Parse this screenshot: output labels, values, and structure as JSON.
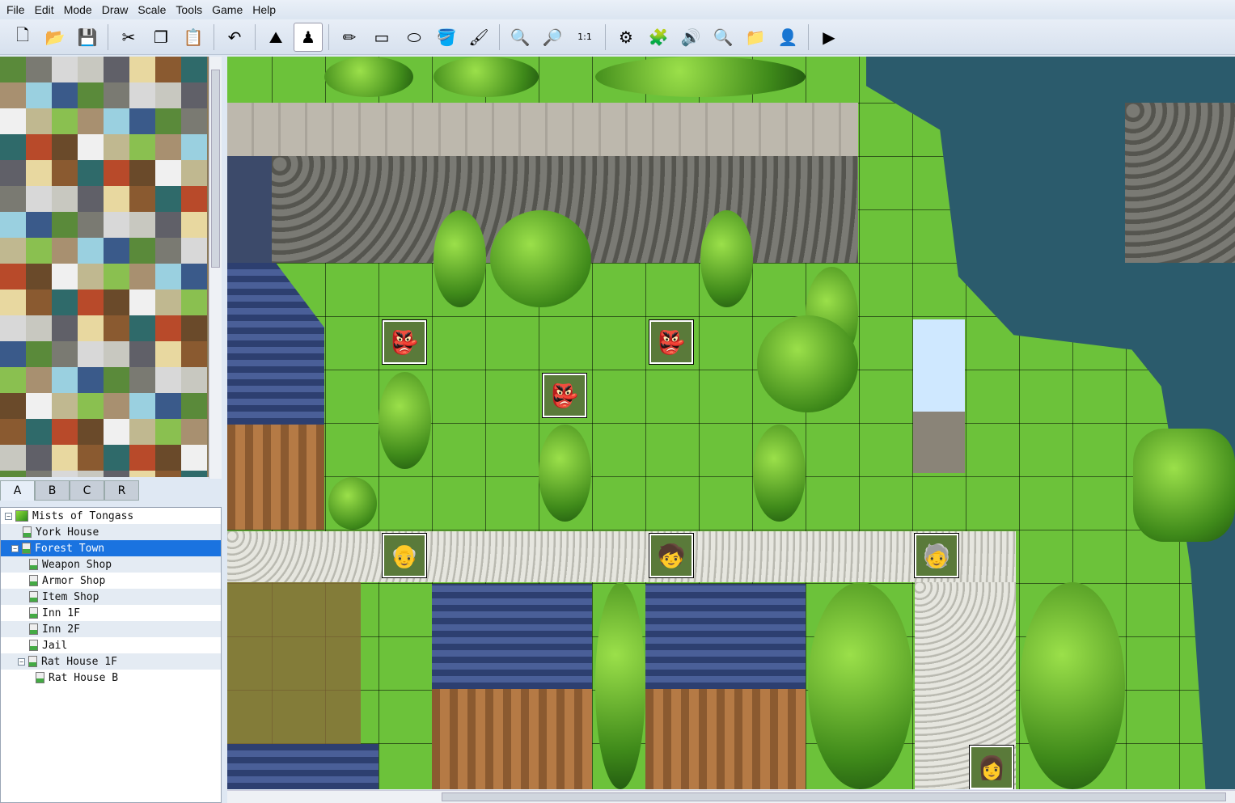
{
  "menu": [
    "File",
    "Edit",
    "Mode",
    "Draw",
    "Scale",
    "Tools",
    "Game",
    "Help"
  ],
  "toolbar": [
    {
      "icon": "new-project-icon",
      "g": "🗋"
    },
    {
      "icon": "open-project-icon",
      "g": "📂"
    },
    {
      "icon": "save-icon",
      "g": "💾"
    },
    "sep",
    {
      "icon": "cut-icon",
      "g": "✂"
    },
    {
      "icon": "copy-icon",
      "g": "❐"
    },
    {
      "icon": "paste-icon",
      "g": "📋"
    },
    "sep",
    {
      "icon": "undo-icon",
      "g": "↶"
    },
    "sep",
    {
      "icon": "map-mode-icon",
      "g": "⛰"
    },
    {
      "icon": "event-mode-icon",
      "g": "♟",
      "active": true
    },
    "sep",
    {
      "icon": "pencil-icon",
      "g": "✏"
    },
    {
      "icon": "rectangle-icon",
      "g": "▭"
    },
    {
      "icon": "ellipse-icon",
      "g": "⬭"
    },
    {
      "icon": "fill-icon",
      "g": "🪣"
    },
    {
      "icon": "shadow-pen-icon",
      "g": "🖌"
    },
    "sep",
    {
      "icon": "zoom-in-icon",
      "g": "🔍"
    },
    {
      "icon": "zoom-out-icon",
      "g": "🔎"
    },
    {
      "icon": "zoom-actual-icon",
      "g": "1:1"
    },
    "sep",
    {
      "icon": "database-icon",
      "g": "⚙"
    },
    {
      "icon": "resource-manager-icon",
      "g": "🧩"
    },
    {
      "icon": "sound-test-icon",
      "g": "🔊"
    },
    {
      "icon": "script-search-icon",
      "g": "🔍"
    },
    {
      "icon": "open-folder-icon",
      "g": "📁"
    },
    {
      "icon": "character-generator-icon",
      "g": "👤"
    },
    "sep",
    {
      "icon": "playtest-icon",
      "g": "▶"
    }
  ],
  "tileset_tabs": [
    "A",
    "B",
    "C",
    "R"
  ],
  "map_tree": [
    {
      "label": "Mists of Tongass",
      "level": 0,
      "expanded": true,
      "root": true
    },
    {
      "label": "York House",
      "level": 1
    },
    {
      "label": "Forest Town",
      "level": 1,
      "expanded": true,
      "selected": true
    },
    {
      "label": "Weapon Shop",
      "level": 2
    },
    {
      "label": "Armor Shop",
      "level": 2
    },
    {
      "label": "Item Shop",
      "level": 2
    },
    {
      "label": "Inn 1F",
      "level": 2
    },
    {
      "label": "Inn 2F",
      "level": 2
    },
    {
      "label": "Jail",
      "level": 2
    },
    {
      "label": "Rat House 1F",
      "level": 2,
      "expanded": true
    },
    {
      "label": "Rat House B",
      "level": 3
    }
  ],
  "colors": {
    "grass": "#6cc23a",
    "water": "#2a5a6a",
    "wall": "#6a6a66",
    "road": "#d8d8d0",
    "selection": "#1a73e0"
  }
}
